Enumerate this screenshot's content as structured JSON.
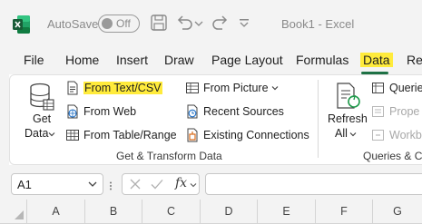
{
  "titlebar": {
    "autosave_label": "AutoSave",
    "autosave_state": "Off",
    "document_title": "Book1  -  Excel"
  },
  "menu": {
    "tabs": [
      {
        "label": "File"
      },
      {
        "label": "Home"
      },
      {
        "label": "Insert"
      },
      {
        "label": "Draw"
      },
      {
        "label": "Page Layout"
      },
      {
        "label": "Formulas"
      },
      {
        "label": "Data",
        "active": true
      },
      {
        "label": "Revi"
      }
    ]
  },
  "ribbon": {
    "get_data": {
      "line1": "Get",
      "line2": "Data"
    },
    "items": {
      "from_text_csv": "From Text/CSV",
      "from_web": "From Web",
      "from_table_range": "From Table/Range",
      "from_picture": "From Picture",
      "recent_sources": "Recent Sources",
      "existing_connections": "Existing Connections"
    },
    "group_get_transform": "Get & Transform Data",
    "refresh": {
      "line1": "Refresh",
      "line2": "All"
    },
    "queries_items": {
      "queries": "Querie",
      "properties": "Prope",
      "workbook_links": "Workbo"
    },
    "group_queries": "Queries & Co"
  },
  "formula_bar": {
    "name_box": "A1",
    "fx": "fx"
  },
  "grid": {
    "columns": [
      "A",
      "B",
      "C",
      "D",
      "E",
      "F",
      "G"
    ]
  },
  "colors": {
    "accent": "#1e7145",
    "highlight": "#ffeb3b"
  }
}
